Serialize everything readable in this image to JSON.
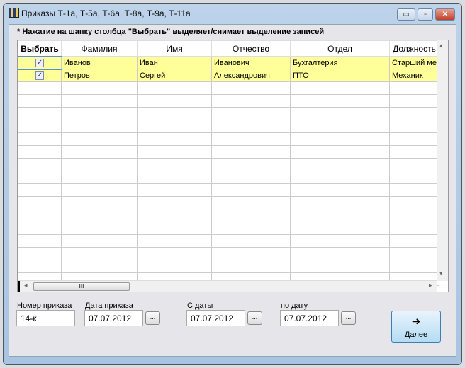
{
  "window": {
    "title": "Приказы Т-1а, Т-5а, Т-6а, Т-8а, Т-9а, Т-11а",
    "minimize": "▭",
    "maximize": "▫",
    "close": "✕"
  },
  "note": "* Нажатие на шапку столбца \"Выбрать\" выделяет/снимает выделение записей",
  "grid": {
    "columns": [
      "Выбрать",
      "Фамилия",
      "Имя",
      "Отчество",
      "Отдел",
      "Должность"
    ],
    "rows": [
      {
        "selected": true,
        "cells": [
          "Иванов",
          "Иван",
          "Иванович",
          "Бухгалтерия",
          "Старший ме"
        ]
      },
      {
        "selected": true,
        "cells": [
          "Петров",
          "Сергей",
          "Александрович",
          "ПТО",
          "Механик"
        ]
      }
    ],
    "check": "✓",
    "scroll_thumb": "III",
    "up": "▴",
    "down": "▾",
    "left": "◂",
    "right": "▸"
  },
  "form": {
    "order_number": {
      "label": "Номер приказа",
      "value": "14-к"
    },
    "order_date": {
      "label": "Дата приказа",
      "value": "07.07.2012"
    },
    "from_date": {
      "label": "С даты",
      "value": "07.07.2012"
    },
    "to_date": {
      "label": "по дату",
      "value": "07.07.2012"
    },
    "picker": "...",
    "next": {
      "arrow": "➜",
      "label": "Далее"
    }
  }
}
